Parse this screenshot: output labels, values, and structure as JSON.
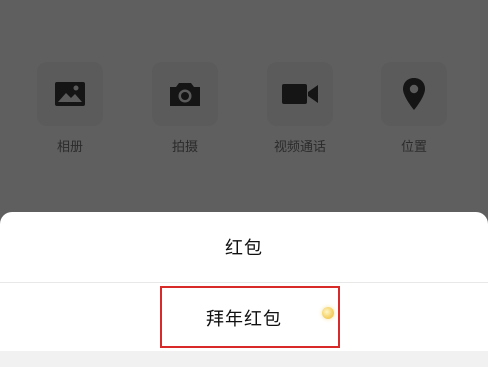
{
  "attachments": [
    {
      "label": "相册",
      "icon": "photo-album-icon"
    },
    {
      "label": "拍摄",
      "icon": "camera-icon"
    },
    {
      "label": "视频通话",
      "icon": "video-call-icon"
    },
    {
      "label": "位置",
      "icon": "location-pin-icon"
    }
  ],
  "sheet": {
    "item_hongbao": "红包",
    "item_bainian": "拜年红包"
  },
  "colors": {
    "overlay": "#5f5f5f",
    "highlight": "#d92a2a",
    "icon": "#151515"
  }
}
